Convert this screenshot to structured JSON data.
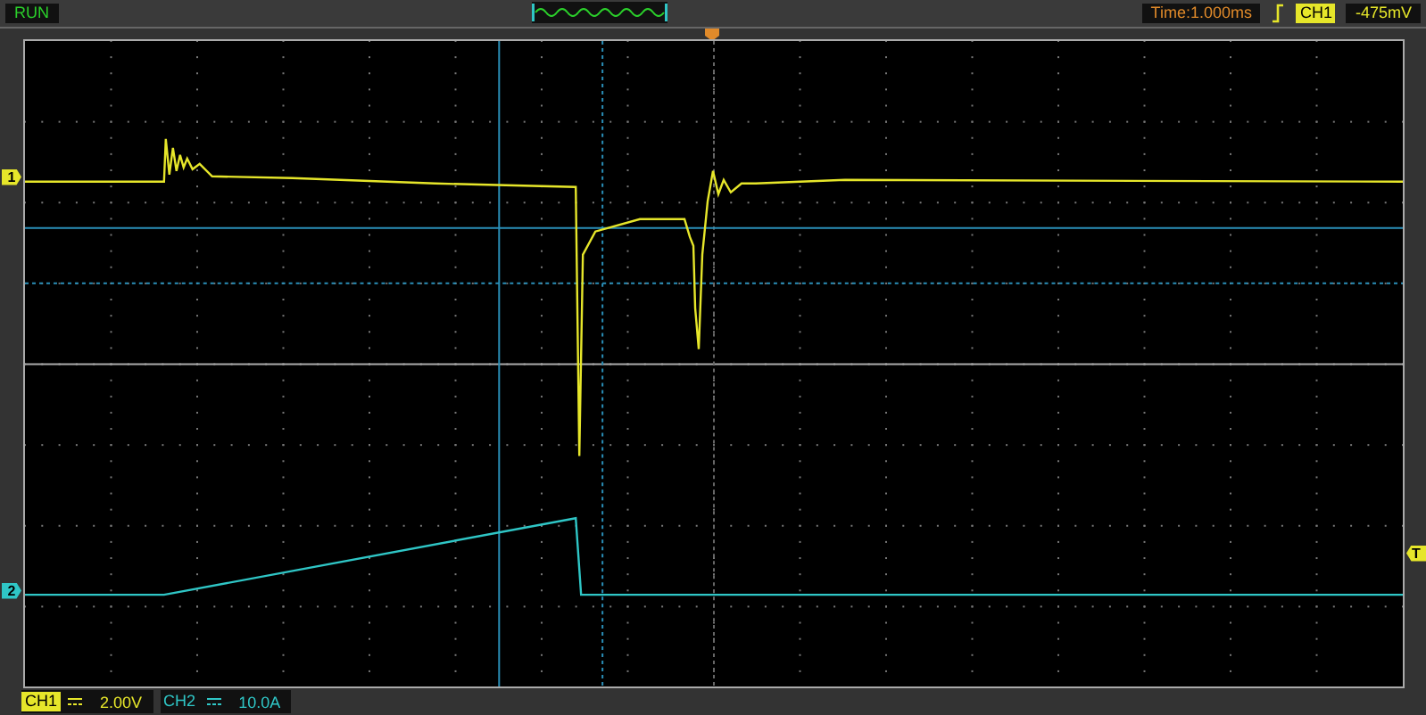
{
  "top_bar": {
    "run_status": "RUN",
    "time_base": "Time:1.000ms",
    "trigger": {
      "channel": "CH1",
      "level": "-475mV"
    }
  },
  "channels": [
    {
      "label": "CH1",
      "scale": "2.00V",
      "marker": "1",
      "color": "#e6e62a"
    },
    {
      "label": "CH2",
      "scale": "10.0A",
      "marker": "2",
      "color": "#2fc6c6"
    }
  ],
  "trigger_marker": "T"
}
